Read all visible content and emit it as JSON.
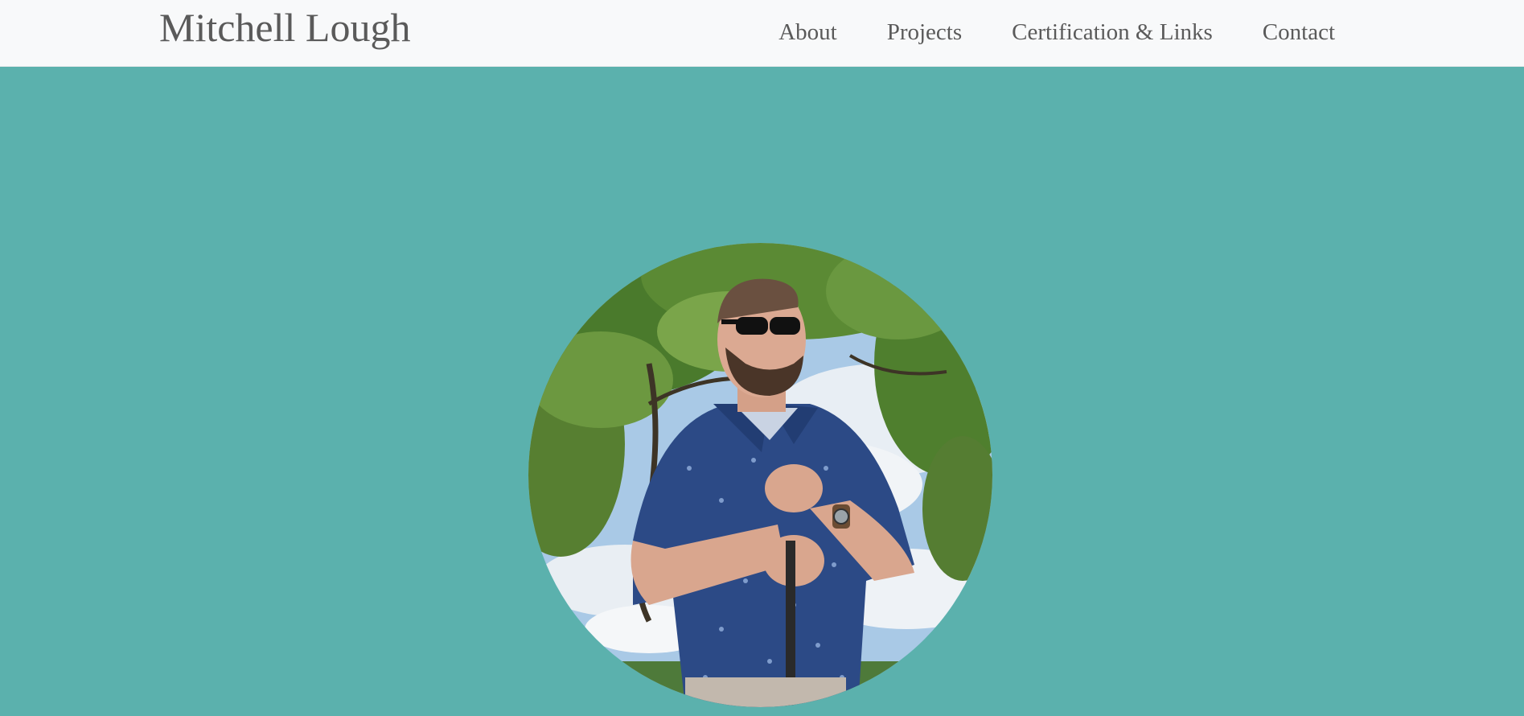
{
  "header": {
    "brand": "Mitchell Lough",
    "nav": [
      {
        "label": "About"
      },
      {
        "label": "Projects"
      },
      {
        "label": "Certification & Links"
      },
      {
        "label": "Contact"
      }
    ]
  },
  "colors": {
    "navbar_bg": "#f8f9fa",
    "hero_bg": "#5bb1ad",
    "nav_text": "#5a5a5a"
  },
  "hero": {
    "photo": "profile-photo"
  }
}
